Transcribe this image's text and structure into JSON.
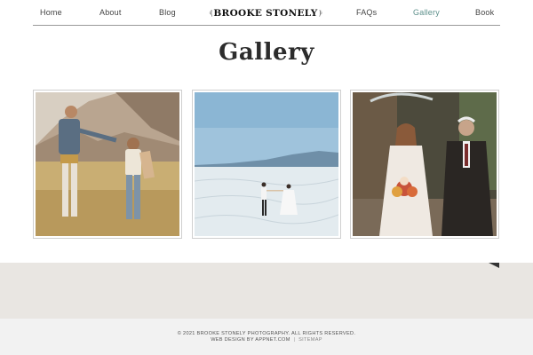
{
  "nav": {
    "items_left": [
      "Home",
      "About",
      "Blog"
    ],
    "logo_text": "BROOKE STONELY",
    "items_right": [
      "FAQs",
      "Gallery",
      "Book"
    ],
    "active_item": "Gallery",
    "active_color": "#5c8f8a"
  },
  "page": {
    "title": "Gallery"
  },
  "gallery": {
    "photos": [
      {
        "icon": "couple-field-photo"
      },
      {
        "icon": "couple-salt-flats-photo"
      },
      {
        "icon": "bride-father-rain-photo"
      }
    ]
  },
  "footer": {
    "copyright": "© 2021 BROOKE STONELY PHOTOGRAPHY. ALL RIGHTS RESERVED.",
    "credit": "WEB DESIGN BY APPNET.COM",
    "separator": "|",
    "sitemap": "SITEMAP"
  },
  "colors": {
    "band": "#e9e6e2",
    "footer_bg": "#f2f2f2"
  }
}
